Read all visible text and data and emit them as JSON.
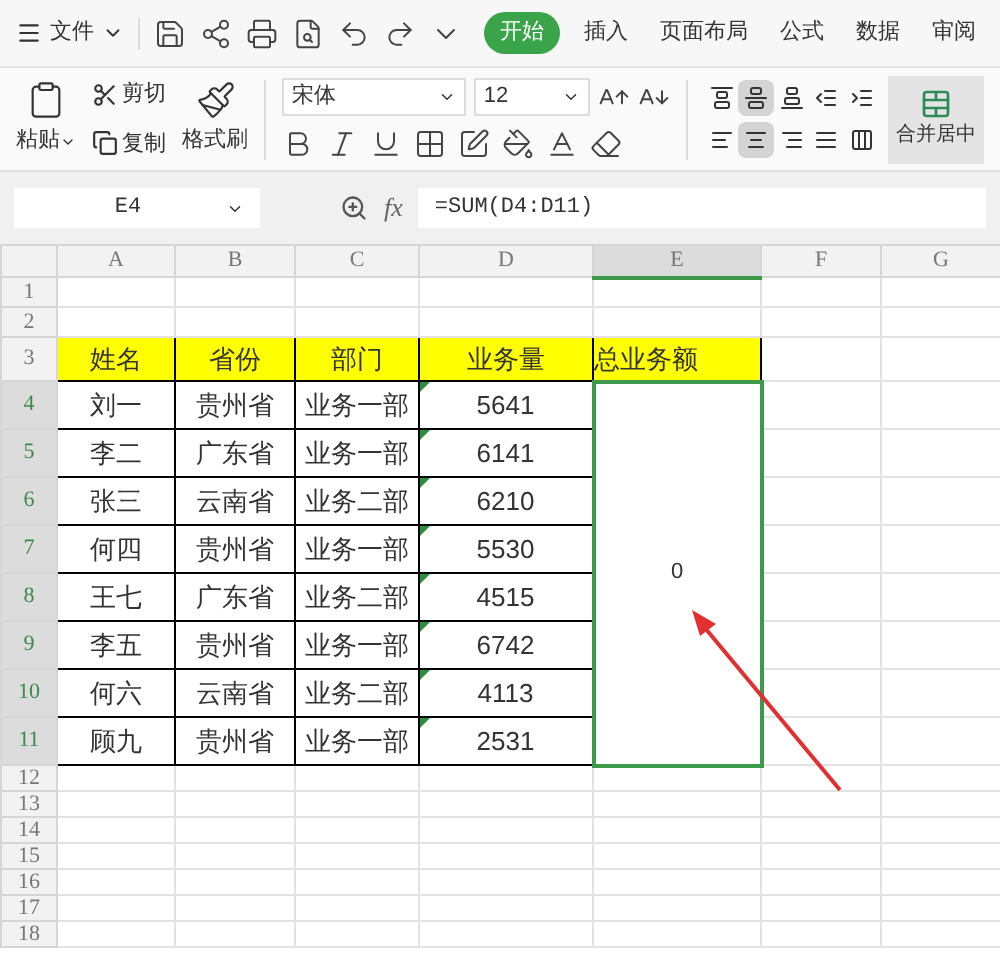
{
  "menu": {
    "file": "文件"
  },
  "tabs": [
    {
      "label": "开始",
      "selected": true
    },
    {
      "label": "插入",
      "selected": false
    },
    {
      "label": "页面布局",
      "selected": false
    },
    {
      "label": "公式",
      "selected": false
    },
    {
      "label": "数据",
      "selected": false
    },
    {
      "label": "审阅",
      "selected": false
    }
  ],
  "ribbon": {
    "paste": "粘贴",
    "cut": "剪切",
    "copy": "复制",
    "format_painter": "格式刷",
    "font": "宋体",
    "font_size": "12",
    "merge": "合并居中",
    "align_buttons": [
      {
        "kind": "top",
        "selected": false
      },
      {
        "kind": "middle",
        "selected": true
      },
      {
        "kind": "bottom",
        "selected": false
      },
      {
        "kind": "indent-less",
        "selected": false
      },
      {
        "kind": "indent-more",
        "selected": false
      },
      {
        "kind": "left",
        "selected": false
      },
      {
        "kind": "center",
        "selected": true
      },
      {
        "kind": "right",
        "selected": false
      },
      {
        "kind": "justify",
        "selected": false
      },
      {
        "kind": "distributed",
        "selected": false
      }
    ]
  },
  "formula_bar": {
    "name_box": "E4",
    "fx": "fx",
    "formula": "=SUM(D4:D11)"
  },
  "columns": [
    {
      "label": "A",
      "selected": false
    },
    {
      "label": "B",
      "selected": false
    },
    {
      "label": "C",
      "selected": false
    },
    {
      "label": "D",
      "selected": false
    },
    {
      "label": "E",
      "selected": true
    },
    {
      "label": "F",
      "selected": false
    },
    {
      "label": "G",
      "selected": false
    }
  ],
  "row_numbers": [
    {
      "label": "1",
      "selected": false
    },
    {
      "label": "2",
      "selected": false
    },
    {
      "label": "3",
      "selected": false
    },
    {
      "label": "4",
      "selected": true
    },
    {
      "label": "5",
      "selected": true
    },
    {
      "label": "6",
      "selected": true
    },
    {
      "label": "7",
      "selected": true
    },
    {
      "label": "8",
      "selected": true
    },
    {
      "label": "9",
      "selected": true
    },
    {
      "label": "10",
      "selected": true
    },
    {
      "label": "11",
      "selected": true
    },
    {
      "label": "12",
      "selected": false
    },
    {
      "label": "13",
      "selected": false
    },
    {
      "label": "14",
      "selected": false
    },
    {
      "label": "15",
      "selected": false
    },
    {
      "label": "16",
      "selected": false
    },
    {
      "label": "17",
      "selected": false
    },
    {
      "label": "18",
      "selected": false
    }
  ],
  "table": {
    "headers": [
      "姓名",
      "省份",
      "部门",
      "业务量",
      "总业务额"
    ],
    "rows": [
      [
        "刘一",
        "贵州省",
        "业务一部",
        "5641"
      ],
      [
        "李二",
        "广东省",
        "业务一部",
        "6141"
      ],
      [
        "张三",
        "云南省",
        "业务二部",
        "6210"
      ],
      [
        "何四",
        "贵州省",
        "业务一部",
        "5530"
      ],
      [
        "王七",
        "广东省",
        "业务二部",
        "4515"
      ],
      [
        "李五",
        "贵州省",
        "业务一部",
        "6742"
      ],
      [
        "何六",
        "云南省",
        "业务二部",
        "4113"
      ],
      [
        "顾九",
        "贵州省",
        "业务一部",
        "2531"
      ]
    ],
    "total": {
      "value": "0",
      "selected": true
    }
  }
}
